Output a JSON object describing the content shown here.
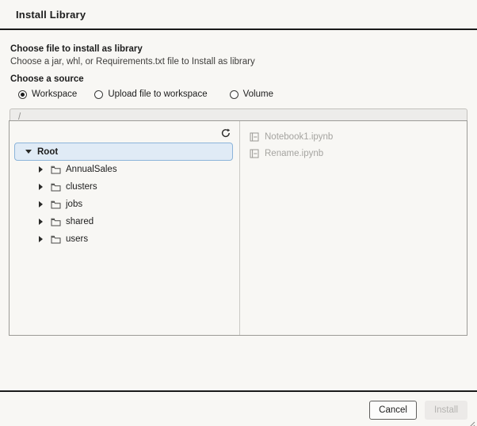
{
  "dialog": {
    "title": "Install Library",
    "section": {
      "heading": "Choose file to install as library",
      "subheading": "Choose a jar, whl, or Requirements.txt file to Install as library"
    },
    "source": {
      "label": "Choose a source",
      "options": [
        {
          "label": "Workspace",
          "selected": true
        },
        {
          "label": "Upload file to workspace",
          "selected": false
        },
        {
          "label": "Volume",
          "selected": false
        }
      ]
    },
    "path_input": {
      "value": "/"
    },
    "browser": {
      "tree": {
        "root": {
          "label": "Root",
          "state": "expanded-selected"
        },
        "folders": [
          "AnnualSales",
          "clusters",
          "jobs",
          "shared",
          "users"
        ]
      },
      "files": [
        "Notebook1.ipynb",
        "Rename.ipynb"
      ],
      "icons": {
        "refresh": "refresh-icon",
        "folder": "folder-icon",
        "notebook": "notebook-icon"
      }
    },
    "footer": {
      "cancel_label": "Cancel",
      "install_label": "Install"
    },
    "colors": {
      "background": "#f8f7f4",
      "divider": "#1a1a1a",
      "selection_fill": "#e0ebf6",
      "selection_border": "#8cb4da",
      "disabled_text": "#a5a4a0"
    }
  }
}
